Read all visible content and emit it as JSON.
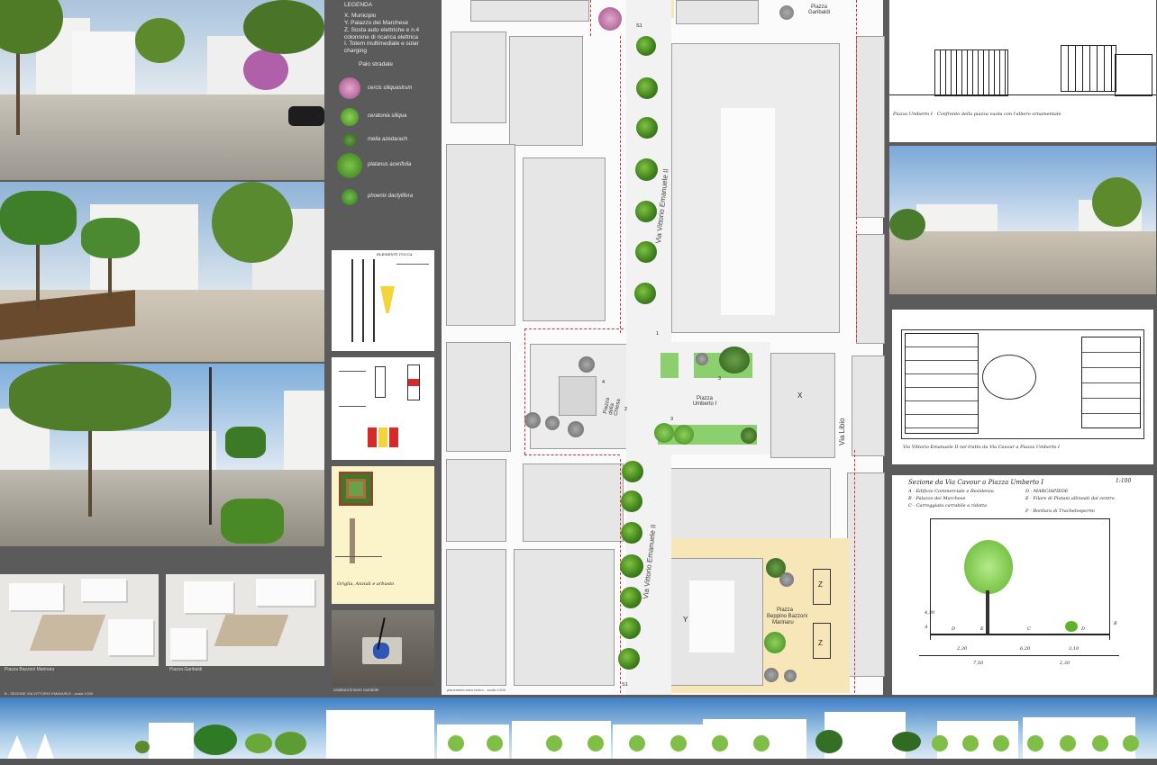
{
  "left_captions": {
    "bazzoni": "Piazza Bazzoni Marinaru",
    "garibaldi": "Piazza Garibaldi",
    "section": "B - SEZIONE VIA VITTORIO EMANUELE - scala 1:500"
  },
  "legend": {
    "title": "LEGENDA",
    "items": [
      {
        "key": "X.",
        "text": "Municipio"
      },
      {
        "key": "Y.",
        "text": "Palazzo dei Marchese"
      },
      {
        "key": "Z.",
        "text": "Sosta auto elettriche e n.4 colonnine di ricarica elettrica"
      },
      {
        "key": "I.",
        "text": "Totem multimediale e solar charging"
      }
    ],
    "lamp": "Palo stradale",
    "plants": [
      {
        "name": "cercis siliquastrum",
        "color": "#c97fb0"
      },
      {
        "name": "ceratonia siliqua",
        "color": "#5fa83a"
      },
      {
        "name": "melia azedarach",
        "color": "#3d6b25"
      },
      {
        "name": "platanus acerifolia",
        "color": "#4e9a2a"
      },
      {
        "name": "phoenix dactylifera",
        "color": "#3f8f2a"
      }
    ]
  },
  "sketches": {
    "s1_title": "ELEMENTI TOCCA",
    "s4_caption": "castitura lineare carrabile",
    "s3_caption": "Griglia, Anziali e arbusto"
  },
  "plan": {
    "street": "Via Vittorio Emanuele II",
    "street2": "Via Libio",
    "garibaldi": "Piazza Garibaldi",
    "umberto": "Piazza Umberto I",
    "chiesa": "Piazza della Chiesa",
    "bazzoni_1": "Piazza",
    "bazzoni_2": "Beppino Bazzoni",
    "bazzoni_3": "Marinaru",
    "mark_x": "X",
    "mark_y": "Y",
    "mark_z": "Z",
    "s1": "S1",
    "n1": "1",
    "n2": "2",
    "n3": "3",
    "n4": "4",
    "caption": "planimetria area centro - scala 1:500"
  },
  "right": {
    "sketch1_caption": "Piazza Umberto I - Confronto della piazza vuota con l'albero ornamentale",
    "sketch2_caption": "Via Vittorio Emanuele II nel tratto da Via Cavour a Piazza Umberto I",
    "section_title": "Sezione da Via Cavour a Piazza Umberto I",
    "scale": "1:100",
    "legend_a": "A - Edificio Commerciale e Residenza",
    "legend_b": "B - Palazzo dei Marchese",
    "legend_c": "C - Carreggiata carrabile a ridotta",
    "legend_d": "D - MARCIAPIEDE",
    "legend_e": "E - Filare di Platani allineati dal centro",
    "legend_f": "F - Bordura di Trachelospermi",
    "dims": [
      "4,30",
      "2,30",
      "6,20",
      "3,10",
      "7,50",
      "2,30"
    ],
    "letters": [
      "A",
      "D",
      "E",
      "C",
      "D",
      "B"
    ]
  }
}
